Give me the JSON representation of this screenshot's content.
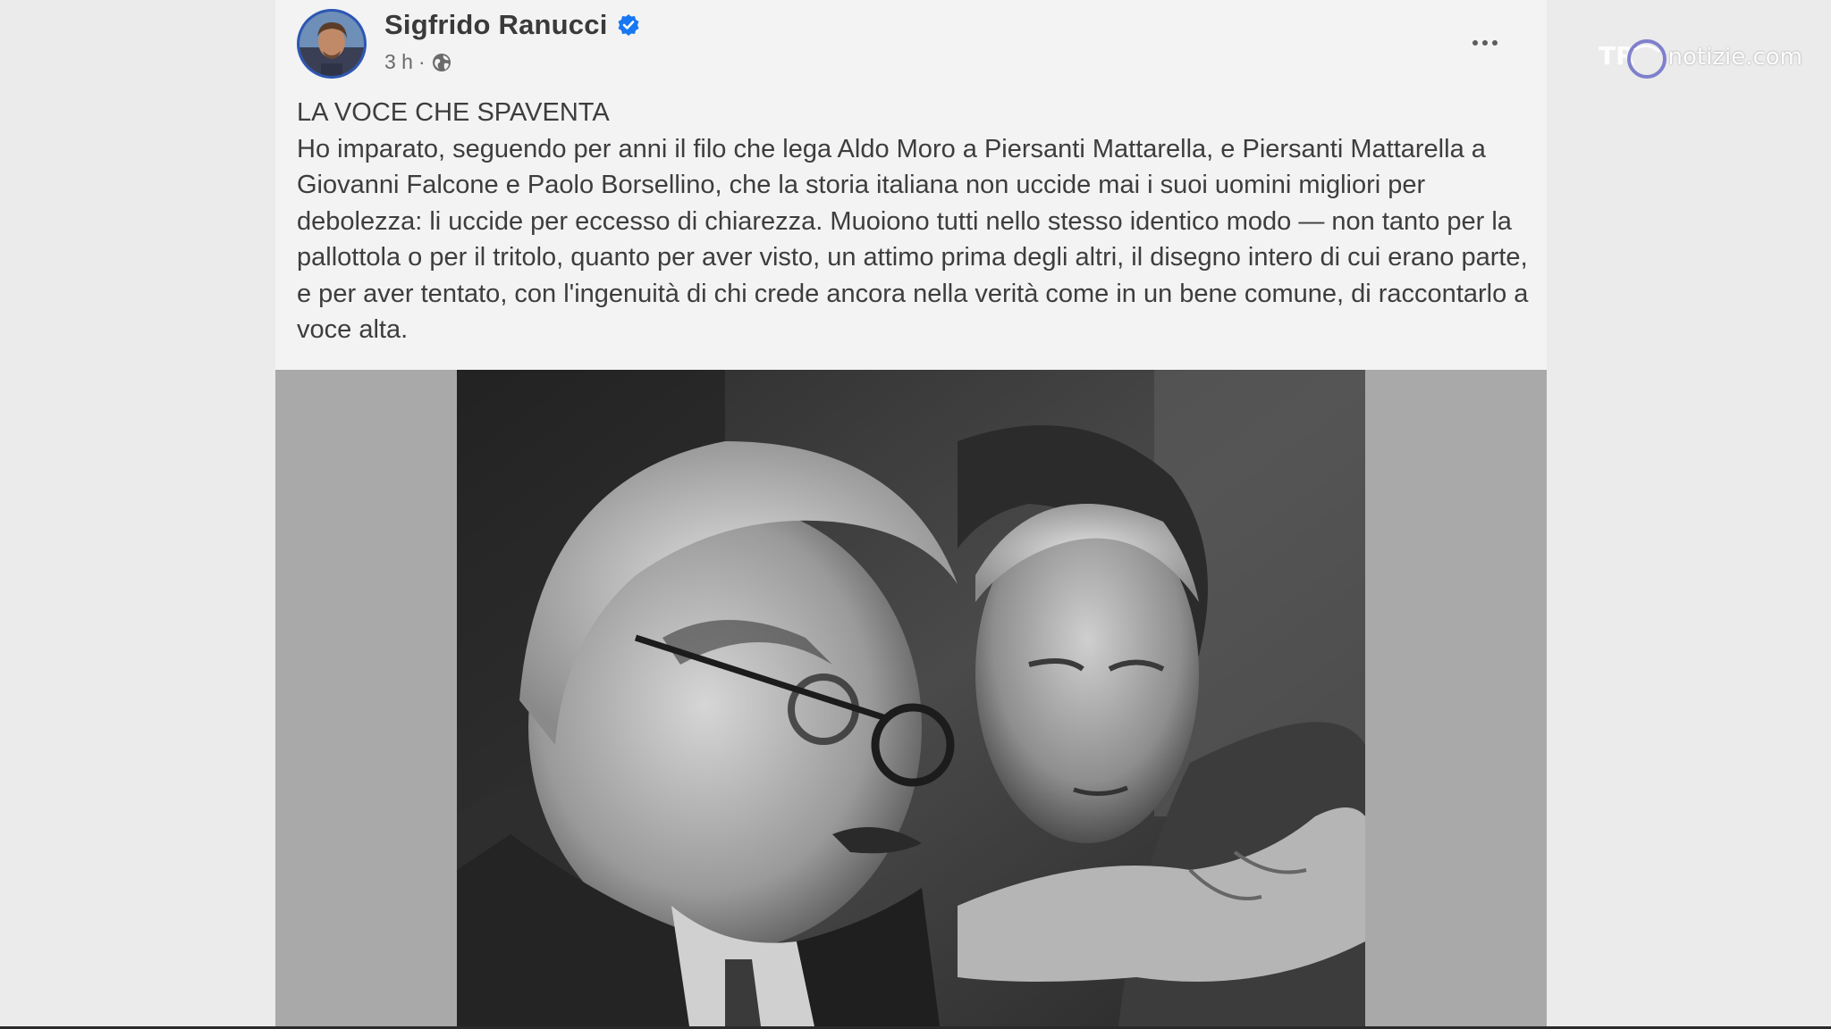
{
  "post": {
    "author_name": "Sigfrido Ranucci",
    "verified_icon": "verified-badge-icon",
    "time_ago": "3 h",
    "separator": "·",
    "privacy_icon": "globe-icon",
    "more_icon": "more-options-icon",
    "title": "LA VOCE CHE SPAVENTA",
    "body": "Ho imparato, seguendo per anni il filo che lega Aldo Moro a Piersanti Mattarella, e Piersanti Mattarella a Giovanni Falcone e Paolo Borsellino, che la storia italiana non uccide mai i suoi uomini migliori per debolezza: li uccide per eccesso di chiarezza. Muoiono tutti nello stesso identico modo — non tanto per la pallottola o per il tritolo, quanto per aver visto, un attimo prima degli altri, il disegno intero di cui erano parte, e per aver tentato, con l'ingenuità di chi crede ancora nella verità come in un bene comune, di raccontarlo a voce alta."
  },
  "watermark": {
    "text": "notizie.com",
    "logo": "trm-logo"
  },
  "colors": {
    "page_background": "#ebebeb",
    "card_background": "#f3f3f3",
    "verified_blue": "#1877f2",
    "text": "#3d3d3d",
    "meta_text": "#6b6b6b"
  }
}
